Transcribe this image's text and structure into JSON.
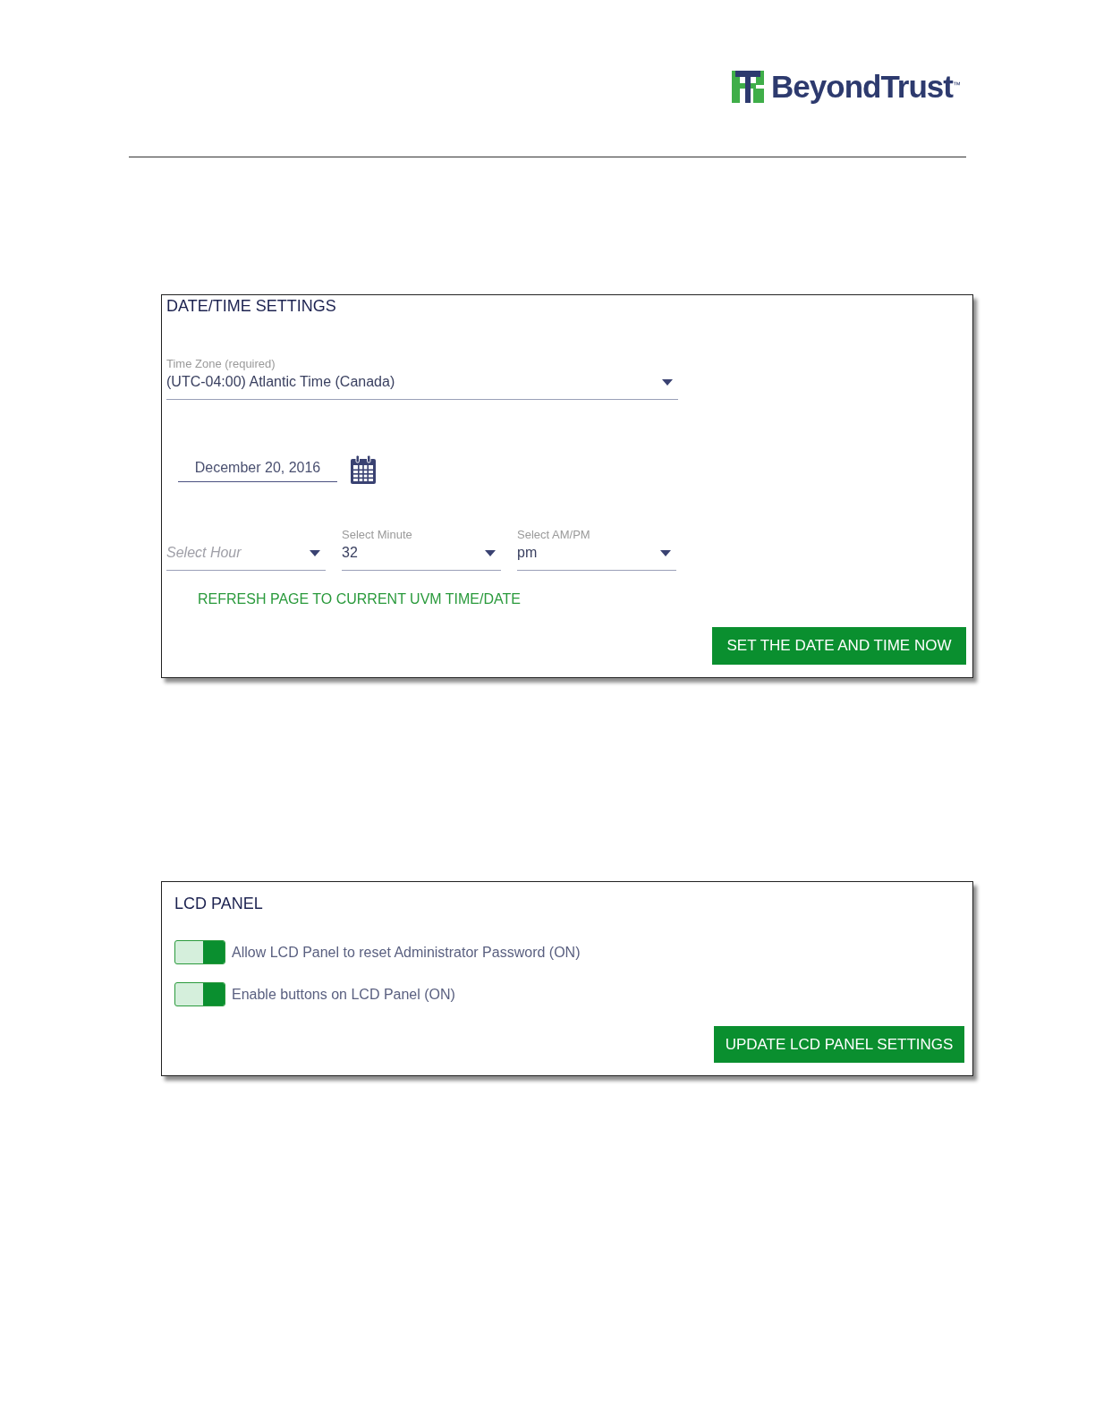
{
  "header": {
    "logo": "BeyondTrust$^{™}$"
  },
  "date_time_panel": {
    "title": "DATE/TIME SETTINGS",
    "timezone": {
      "label": "Time Zone (required)",
      "value": "(UTC-04:00) Atlantic Time (Canada)"
    },
    "date": {
      "value": "December 20, 2016"
    },
    "time_selects": [
      {
        "placeholder": "Select Hour"
      },
      {
        "label": "Select Minute",
        "value": "32"
      },
      {
        "label": "Select AM/PM",
        "value": "pm"
      }
    ],
    "link": "REFRESH PAGE TO CURRENT UVM TIME/DATE",
    "button": "SET THE DATE AND TIME NOW"
  },
  "lcd_panel": {
    "title": "LCD PANEL",
    "toggles": [
      {
        "label": "Allow LCD Panel to reset Administrator Password (ON)",
        "on": true
      },
      {
        "label": "Enable buttons on LCD Panel (ON)",
        "on": true
      }
    ],
    "button": "UPDATE LCD PANEL SETTINGS"
  }
}
